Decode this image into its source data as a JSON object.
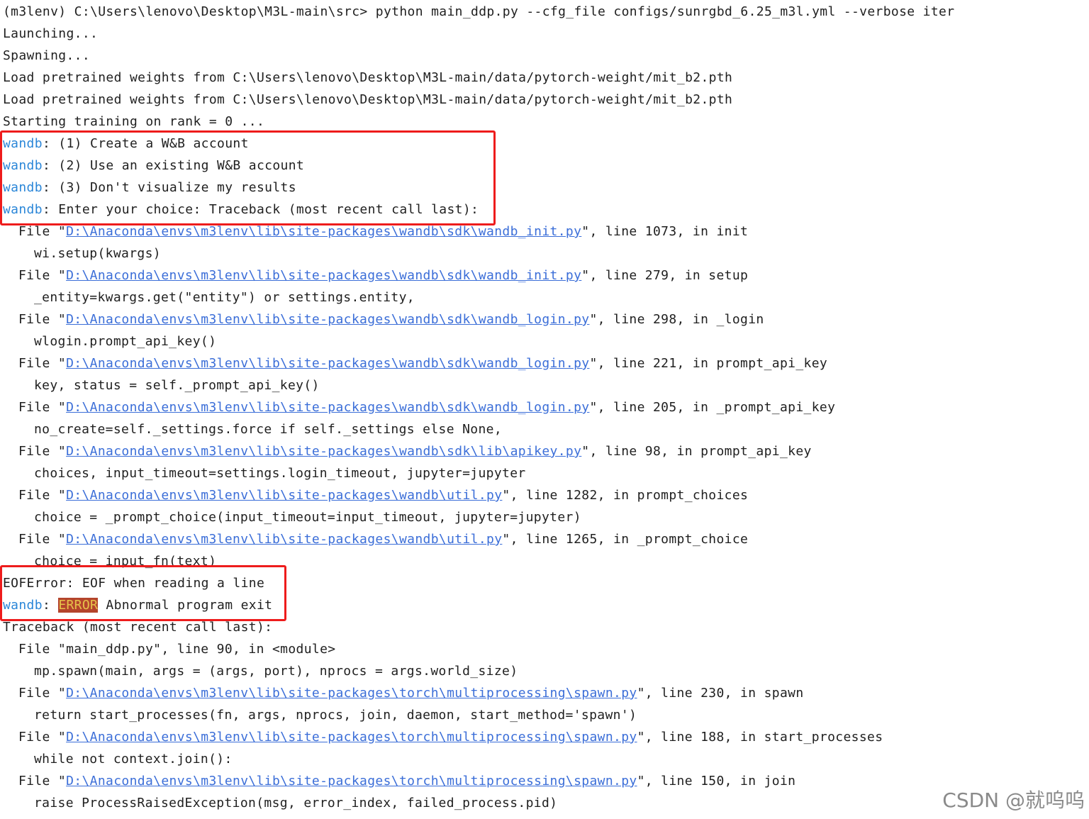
{
  "lines": [
    {
      "text": "(m3lenv) C:\\Users\\lenovo\\Desktop\\M3L-main\\src> python main_ddp.py --cfg_file configs/sunrgbd_6.25_m3l.yml --verbose iter"
    },
    {
      "text": "Launching..."
    },
    {
      "text": "Spawning..."
    },
    {
      "text": "Load pretrained weights from C:\\Users\\lenovo\\Desktop\\M3L-main/data/pytorch-weight/mit_b2.pth"
    },
    {
      "text": "Load pretrained weights from C:\\Users\\lenovo\\Desktop\\M3L-main/data/pytorch-weight/mit_b2.pth"
    },
    {
      "text": "Starting training on rank = 0 ..."
    },
    {
      "prefix": "wandb",
      "text": ": (1) Create a W&B account"
    },
    {
      "prefix": "wandb",
      "text": ": (2) Use an existing W&B account"
    },
    {
      "prefix": "wandb",
      "text": ": (3) Don't visualize my results"
    },
    {
      "prefix": "wandb",
      "text": ": Enter your choice: Traceback (most recent call last):"
    },
    {
      "pre": "File \"",
      "link": "D:\\Anaconda\\envs\\m3lenv\\lib\\site-packages\\wandb\\sdk\\wandb_init.py",
      "post": "\", line 1073, in init"
    },
    {
      "text": "wi.setup(kwargs)"
    },
    {
      "pre": "File \"",
      "link": "D:\\Anaconda\\envs\\m3lenv\\lib\\site-packages\\wandb\\sdk\\wandb_init.py",
      "post": "\", line 279, in setup"
    },
    {
      "text": "_entity=kwargs.get(\"entity\") or settings.entity,"
    },
    {
      "pre": "File \"",
      "link": "D:\\Anaconda\\envs\\m3lenv\\lib\\site-packages\\wandb\\sdk\\wandb_login.py",
      "post": "\", line 298, in _login"
    },
    {
      "text": "wlogin.prompt_api_key()"
    },
    {
      "pre": "File \"",
      "link": "D:\\Anaconda\\envs\\m3lenv\\lib\\site-packages\\wandb\\sdk\\wandb_login.py",
      "post": "\", line 221, in prompt_api_key"
    },
    {
      "text": "key, status = self._prompt_api_key()"
    },
    {
      "pre": "File \"",
      "link": "D:\\Anaconda\\envs\\m3lenv\\lib\\site-packages\\wandb\\sdk\\wandb_login.py",
      "post": "\", line 205, in _prompt_api_key"
    },
    {
      "text": "no_create=self._settings.force if self._settings else None,"
    },
    {
      "pre": "File \"",
      "link": "D:\\Anaconda\\envs\\m3lenv\\lib\\site-packages\\wandb\\sdk\\lib\\apikey.py",
      "post": "\", line 98, in prompt_api_key"
    },
    {
      "text": "choices, input_timeout=settings.login_timeout, jupyter=jupyter"
    },
    {
      "pre": "File \"",
      "link": "D:\\Anaconda\\envs\\m3lenv\\lib\\site-packages\\wandb\\util.py",
      "post": "\", line 1282, in prompt_choices"
    },
    {
      "text": "choice = _prompt_choice(input_timeout=input_timeout, jupyter=jupyter)"
    },
    {
      "pre": "File \"",
      "link": "D:\\Anaconda\\envs\\m3lenv\\lib\\site-packages\\wandb\\util.py",
      "post": "\", line 1265, in _prompt_choice"
    },
    {
      "text": "choice = input_fn(text)"
    },
    {
      "text": "EOFError: EOF when reading a line"
    },
    {
      "prefix": "wandb",
      "text": ": ",
      "badge": "ERROR",
      "post": " Abnormal program exit"
    },
    {
      "text": "Traceback (most recent call last):"
    },
    {
      "text": "File \"main_ddp.py\", line 90, in <module>"
    },
    {
      "text": "mp.spawn(main, args = (args, port), nprocs = args.world_size)"
    },
    {
      "pre": "File \"",
      "link": "D:\\Anaconda\\envs\\m3lenv\\lib\\site-packages\\torch\\multiprocessing\\spawn.py",
      "post": "\", line 230, in spawn"
    },
    {
      "text": "return start_processes(fn, args, nprocs, join, daemon, start_method='spawn')"
    },
    {
      "pre": "File \"",
      "link": "D:\\Anaconda\\envs\\m3lenv\\lib\\site-packages\\torch\\multiprocessing\\spawn.py",
      "post": "\", line 188, in start_processes"
    },
    {
      "text": "while not context.join():"
    },
    {
      "pre": "File \"",
      "link": "D:\\Anaconda\\envs\\m3lenv\\lib\\site-packages\\torch\\multiprocessing\\spawn.py",
      "post": "\", line 150, in join"
    },
    {
      "text": "raise ProcessRaisedException(msg, error_index, failed_process.pid)"
    }
  ],
  "watermark": "CSDN @就呜呜",
  "colors": {
    "prefix": "#2a86d8",
    "link": "#3b6ed8",
    "highlight_box": "#ee1c1c",
    "error_badge_bg": "#b4442c",
    "error_badge_fg": "#e6c24a"
  }
}
